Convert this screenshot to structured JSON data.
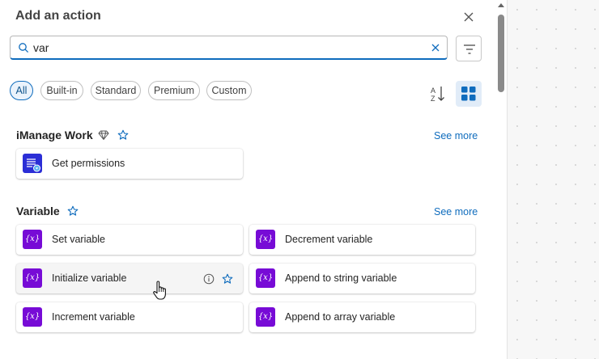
{
  "header": {
    "title": "Add an action"
  },
  "search": {
    "value": "var",
    "placeholder": ""
  },
  "filters": [
    "All",
    "Built-in",
    "Standard",
    "Premium",
    "Custom"
  ],
  "active_filter": "All",
  "colors": {
    "accent": "#0f6cbd",
    "variable_icon": "#770bd6",
    "imanage_icon": "#2b2ed6"
  },
  "sections": {
    "imanage": {
      "title": "iManage Work",
      "see_more": "See more",
      "items": [
        {
          "label": "Get permissions",
          "icon": "imanage-connector-icon"
        }
      ]
    },
    "variable": {
      "title": "Variable",
      "see_more": "See more",
      "icon_glyph": "{x}",
      "items": [
        {
          "label": "Set variable"
        },
        {
          "label": "Decrement variable"
        },
        {
          "label": "Initialize variable"
        },
        {
          "label": "Append to string variable"
        },
        {
          "label": "Increment variable"
        },
        {
          "label": "Append to array variable"
        }
      ]
    }
  }
}
